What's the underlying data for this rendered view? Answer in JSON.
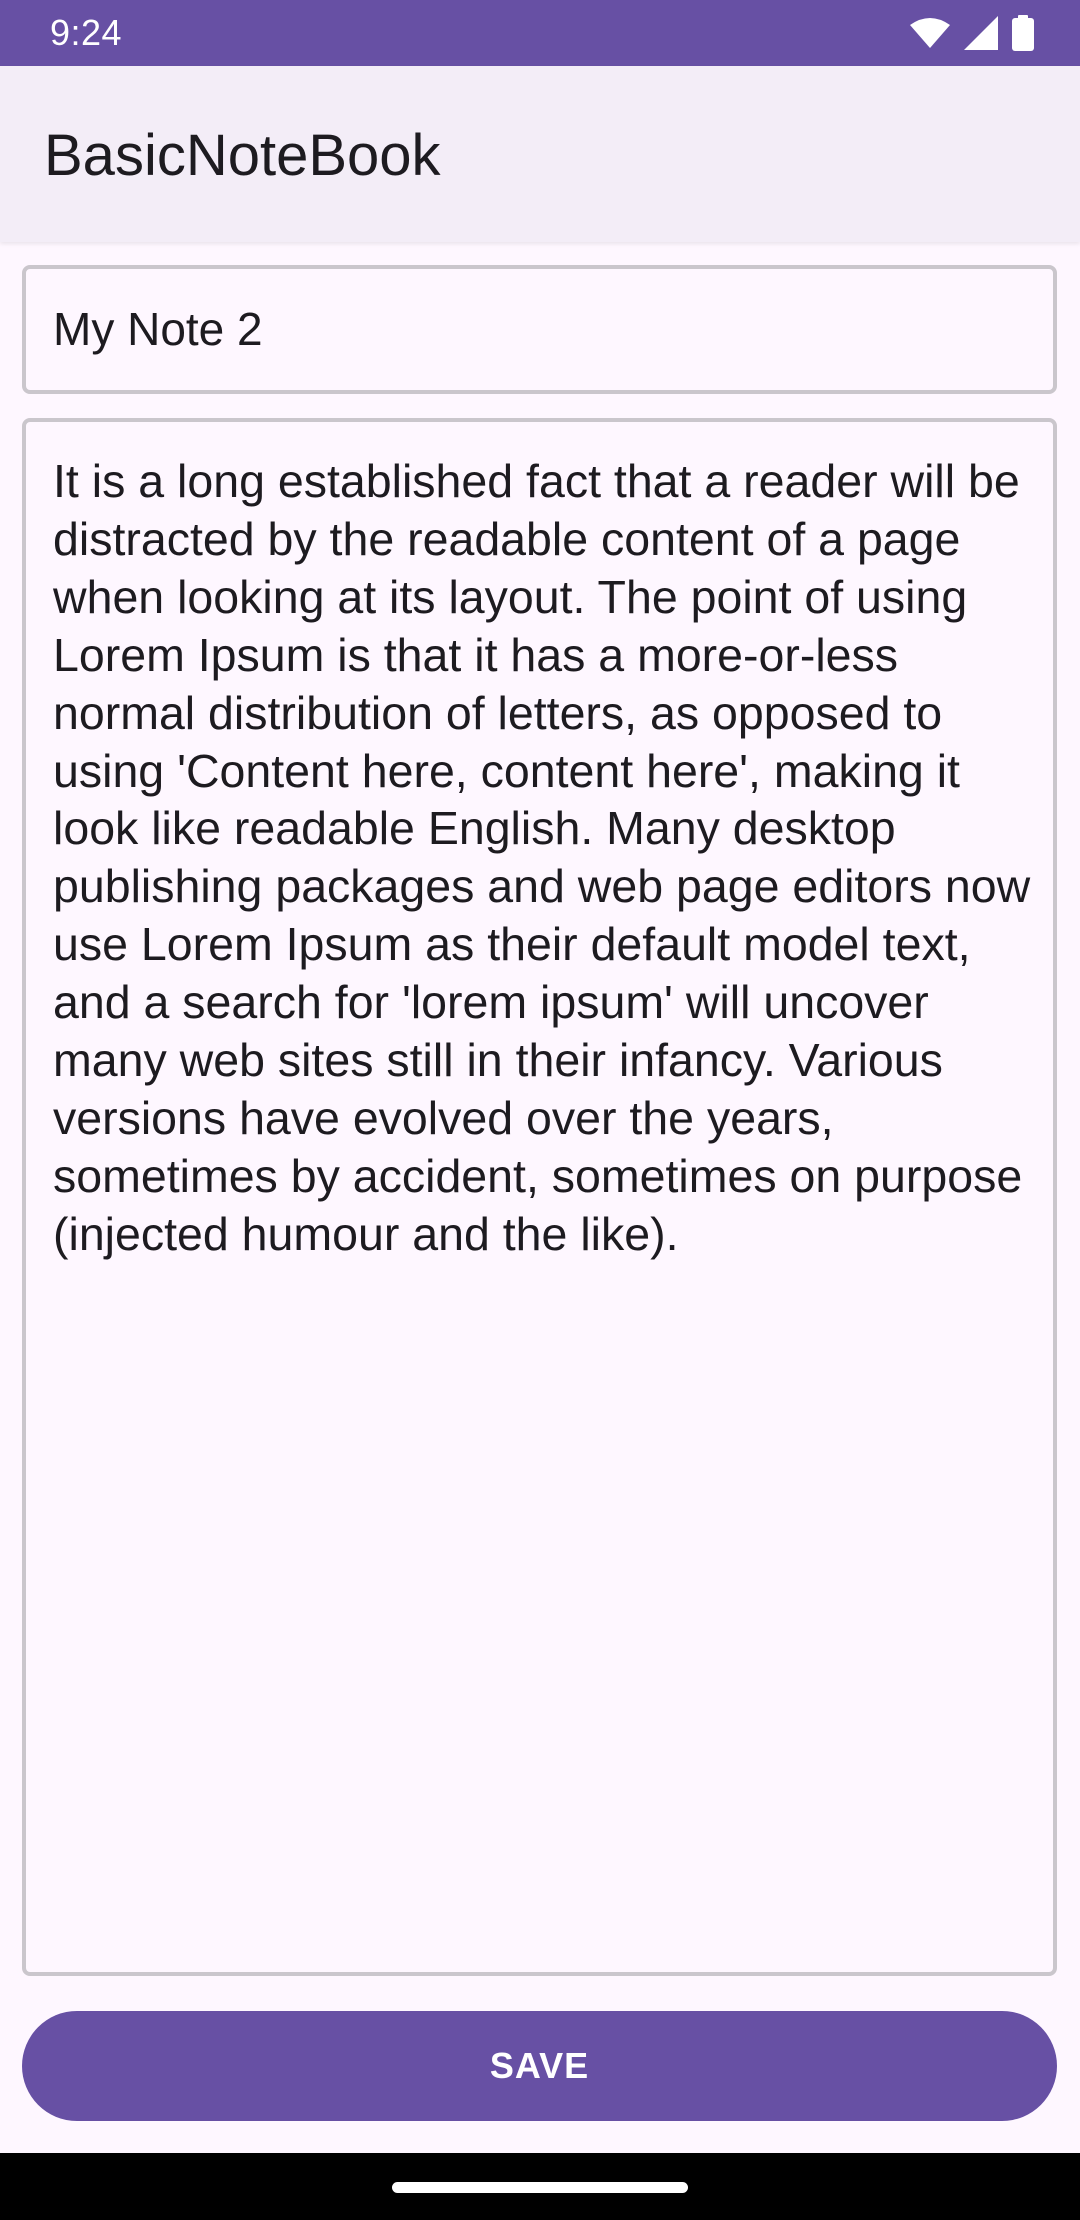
{
  "status_bar": {
    "time": "9:24",
    "icons": [
      "wifi-icon",
      "signal-icon",
      "battery-icon"
    ],
    "background_color": "#6750a4"
  },
  "app_bar": {
    "title": "BasicNoteBook"
  },
  "note": {
    "title_value": "My Note 2",
    "body_value": "It is a long established fact that a reader will be distracted by the readable content of a page when looking at its layout. The point of using Lorem Ipsum is that it has a more-or-less normal distribution of letters, as opposed to using 'Content here, content here', making it look like readable English. Many desktop publishing packages and web page editors now use Lorem Ipsum as their default model text, and a search for 'lorem ipsum' will uncover many web sites still in their infancy. Various versions have evolved over the years, sometimes by accident, sometimes on purpose (injected humour and the like)."
  },
  "actions": {
    "save_label": "SAVE",
    "save_color": "#6750a4"
  }
}
